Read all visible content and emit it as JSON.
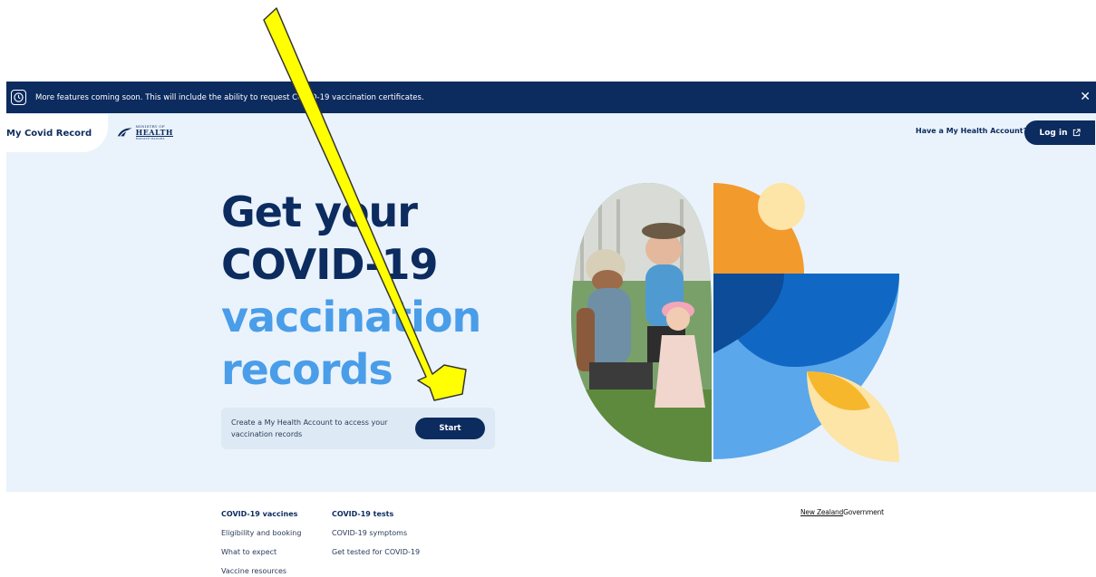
{
  "banner": {
    "text": "More features coming soon. This will include the ability to request COVID-19 vaccination certificates.",
    "icon": "clock-icon",
    "close": "✕"
  },
  "header": {
    "brand": "My Covid Record",
    "logo": {
      "line1": "MINISTRY OF",
      "line2": "HEALTH",
      "line3": "MANATŪ HAUORA"
    },
    "account_question": "Have a My Health Account?",
    "login_label": "Log in"
  },
  "hero": {
    "title_line1": "Get your",
    "title_line2": "COVID-19",
    "title_line3": "vaccination",
    "title_line4": "records",
    "cta_text": "Create a My Health Account to access your vaccination records",
    "start_label": "Start"
  },
  "footer": {
    "col1": {
      "heading": "COVID-19 vaccines",
      "links": [
        "Eligibility and booking",
        "What to expect",
        "Vaccine resources"
      ]
    },
    "col2": {
      "heading": "COVID-19 tests",
      "links": [
        "COVID-19 symptoms",
        "Get tested for COVID-19"
      ]
    },
    "gov_logo_a": "New Zealand",
    "gov_logo_b": "Government"
  },
  "colors": {
    "navy": "#0c2b5f",
    "light_blue": "#4a9de8",
    "hero_bg": "#eaf3fb",
    "orange": "#f39a2c",
    "yellow_arrow": "#ffff00"
  }
}
